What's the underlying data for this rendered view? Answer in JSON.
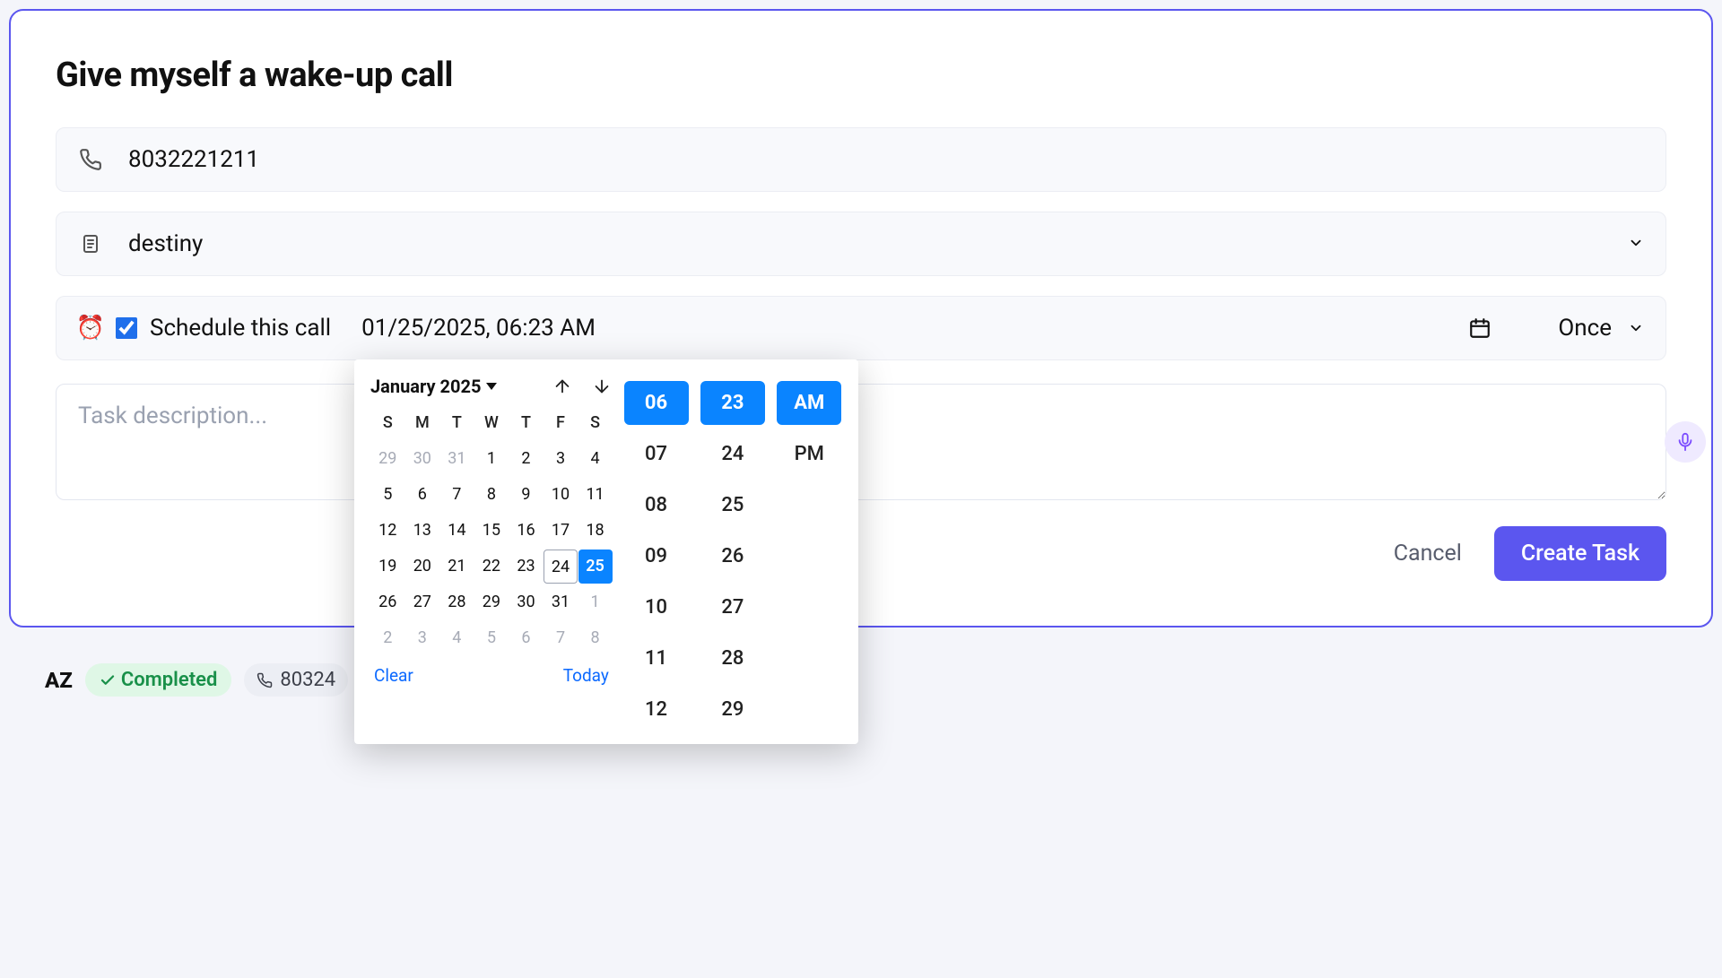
{
  "card": {
    "title": "Give myself a wake-up call"
  },
  "phone": {
    "value": "8032221211"
  },
  "select": {
    "value": "destiny"
  },
  "schedule": {
    "checkbox_label": "Schedule this call",
    "checked": true,
    "datetime_display": "01/25/2025, 06:23 AM",
    "frequency": "Once"
  },
  "datepicker": {
    "month_label": "January 2025",
    "dow": [
      "S",
      "M",
      "T",
      "W",
      "T",
      "F",
      "S"
    ],
    "weeks": [
      [
        {
          "d": "29",
          "o": true
        },
        {
          "d": "30",
          "o": true
        },
        {
          "d": "31",
          "o": true
        },
        {
          "d": "1"
        },
        {
          "d": "2"
        },
        {
          "d": "3"
        },
        {
          "d": "4"
        }
      ],
      [
        {
          "d": "5"
        },
        {
          "d": "6"
        },
        {
          "d": "7"
        },
        {
          "d": "8"
        },
        {
          "d": "9"
        },
        {
          "d": "10"
        },
        {
          "d": "11"
        }
      ],
      [
        {
          "d": "12"
        },
        {
          "d": "13"
        },
        {
          "d": "14"
        },
        {
          "d": "15"
        },
        {
          "d": "16"
        },
        {
          "d": "17"
        },
        {
          "d": "18"
        }
      ],
      [
        {
          "d": "19"
        },
        {
          "d": "20"
        },
        {
          "d": "21"
        },
        {
          "d": "22"
        },
        {
          "d": "23"
        },
        {
          "d": "24",
          "today": true
        },
        {
          "d": "25",
          "sel": true
        }
      ],
      [
        {
          "d": "26"
        },
        {
          "d": "27"
        },
        {
          "d": "28"
        },
        {
          "d": "29"
        },
        {
          "d": "30"
        },
        {
          "d": "31"
        },
        {
          "d": "1",
          "o": true
        }
      ],
      [
        {
          "d": "2",
          "o": true
        },
        {
          "d": "3",
          "o": true
        },
        {
          "d": "4",
          "o": true
        },
        {
          "d": "5",
          "o": true
        },
        {
          "d": "6",
          "o": true
        },
        {
          "d": "7",
          "o": true
        },
        {
          "d": "8",
          "o": true
        }
      ]
    ],
    "clear_label": "Clear",
    "today_label": "Today",
    "hours": [
      "06",
      "07",
      "08",
      "09",
      "10",
      "11",
      "12"
    ],
    "hour_selected": "06",
    "minutes": [
      "23",
      "24",
      "25",
      "26",
      "27",
      "28",
      "29"
    ],
    "minute_selected": "23",
    "meridiem": [
      "AM",
      "PM"
    ],
    "meridiem_selected": "AM"
  },
  "description": {
    "placeholder": "Task description...",
    "value": ""
  },
  "actions": {
    "cancel": "Cancel",
    "create": "Create Task"
  },
  "below": {
    "code": "AZ",
    "status": "Completed",
    "phone_partial": "80324"
  }
}
